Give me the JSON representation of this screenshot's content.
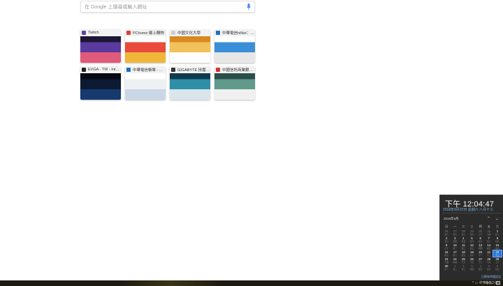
{
  "search": {
    "placeholder": "在 Google 上搜尋或輸入網址"
  },
  "tiles": [
    {
      "title": "Twitch",
      "favicon_color": "#6441a4",
      "thumb_colors": [
        "#1d1636",
        "#5b3aa0",
        "#e05a7a"
      ]
    },
    {
      "title": "PChome 線上購物",
      "favicon_color": "#e33d2f",
      "thumb_colors": [
        "#ffffff",
        "#e84a3c",
        "#f0b63a"
      ]
    },
    {
      "title": "中國文化大學",
      "favicon_color": "#cfcfcf",
      "thumb_colors": [
        "#d68a1f",
        "#f2c15c",
        "#ffffff"
      ]
    },
    {
      "title": "中華電信hiNet：4...",
      "favicon_color": "#1a6fc2",
      "thumb_colors": [
        "#ffffff",
        "#3b8fd8",
        "#e6e6e6"
      ]
    },
    {
      "title": "EVGA - TW - Intelli...",
      "favicon_color": "#222222",
      "thumb_colors": [
        "#050a14",
        "#0d1a33",
        "#163a6e"
      ]
    },
    {
      "title": "中華電信帳單 - 網...",
      "favicon_color": "#1a6fc2",
      "thumb_colors": [
        "#ffffff",
        "#eef1f4",
        "#c9d7e6"
      ]
    },
    {
      "title": "GIGABYTE 技嘉科技",
      "favicon_color": "#333333",
      "thumb_colors": [
        "#0f3b4d",
        "#2f8fa8",
        "#d9e6ec"
      ]
    },
    {
      "title": "中國信託商業銀行 -",
      "favicon_color": "#d6312b",
      "thumb_colors": [
        "#2b4e4a",
        "#5f9a8a",
        "#f0f0f0"
      ]
    }
  ],
  "clock": {
    "time": "下午 12:04:47",
    "date": "2018年9月22日 星期六 八月十三",
    "month": "2018年9月",
    "nav_up": "⌃",
    "nav_down": "⌄",
    "weekdays": [
      "日",
      "一",
      "二",
      "三",
      "四",
      "五",
      "六"
    ],
    "weeks": [
      [
        [
          "26",
          "廿六",
          true
        ],
        [
          "27",
          "廿七",
          true
        ],
        [
          "28",
          "廿八",
          true
        ],
        [
          "29",
          "廿九",
          true
        ],
        [
          "30",
          "三十",
          true
        ],
        [
          "31",
          "七月",
          true
        ],
        [
          "1",
          "廿二",
          false
        ]
      ],
      [
        [
          "2",
          "廿三",
          false
        ],
        [
          "3",
          "廿四",
          false
        ],
        [
          "4",
          "廿五",
          false
        ],
        [
          "5",
          "廿六",
          false
        ],
        [
          "6",
          "廿七",
          false
        ],
        [
          "7",
          "廿八",
          false
        ],
        [
          "8",
          "廿九",
          false
        ]
      ],
      [
        [
          "9",
          "三十",
          false
        ],
        [
          "10",
          "初一",
          false
        ],
        [
          "11",
          "初二",
          false
        ],
        [
          "12",
          "初三",
          false
        ],
        [
          "13",
          "初四",
          false
        ],
        [
          "14",
          "初五",
          false
        ],
        [
          "15",
          "初六",
          false
        ]
      ],
      [
        [
          "16",
          "初七",
          false
        ],
        [
          "17",
          "初八",
          false
        ],
        [
          "18",
          "初九",
          false
        ],
        [
          "19",
          "初十",
          false
        ],
        [
          "20",
          "十一",
          false
        ],
        [
          "21",
          "十二",
          false
        ],
        [
          "22",
          "十三",
          false
        ]
      ],
      [
        [
          "23",
          "十四",
          false
        ],
        [
          "24",
          "中秋",
          false
        ],
        [
          "25",
          "十六",
          false
        ],
        [
          "26",
          "十七",
          false
        ],
        [
          "27",
          "十八",
          false
        ],
        [
          "28",
          "十九",
          false
        ],
        [
          "29",
          "二十",
          false
        ]
      ],
      [
        [
          "30",
          "廿一",
          false
        ],
        [
          "1",
          "廿二",
          true
        ],
        [
          "2",
          "廿三",
          true
        ],
        [
          "3",
          "廿四",
          true
        ],
        [
          "4",
          "廿五",
          true
        ],
        [
          "5",
          "廿六",
          true
        ],
        [
          "6",
          "廿七",
          true
        ]
      ]
    ],
    "today": "22",
    "settings_label": "日期和時間設定"
  },
  "taskbar": {
    "tray_text": "^ ▭ 中 %(d)",
    "clock_text": "下午 12:04"
  }
}
